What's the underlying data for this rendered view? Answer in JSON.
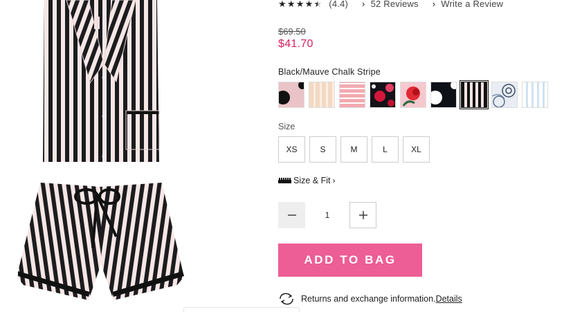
{
  "rating": {
    "stars_value": 4.4,
    "value_text": "(4.4)",
    "reviews_link": "52 Reviews",
    "write_review_link": "Write a Review"
  },
  "price": {
    "original": "$69.50",
    "sale": "$41.70",
    "sale_color": "#d6225f"
  },
  "color": {
    "selected_name": "Black/Mauve Chalk Stripe",
    "swatches": [
      {
        "name": "pink-black-dot",
        "selected": false
      },
      {
        "name": "beige-stripe",
        "selected": false
      },
      {
        "name": "pink-white-stripe",
        "selected": false
      },
      {
        "name": "black-red-floral",
        "selected": false
      },
      {
        "name": "pink-red-rose",
        "selected": false
      },
      {
        "name": "black-white-dot",
        "selected": false
      },
      {
        "name": "black-mauve-chalk-stripe",
        "selected": true
      },
      {
        "name": "blue-rose-sketch",
        "selected": false
      },
      {
        "name": "blue-white-stripe",
        "selected": false
      }
    ]
  },
  "size": {
    "label": "Size",
    "options": [
      "XS",
      "S",
      "M",
      "L",
      "XL"
    ],
    "fit_link": "Size & Fit",
    "fit_icon": "ruler-icon"
  },
  "quantity": {
    "value": "1",
    "minus_icon": "minus-icon",
    "plus_icon": "plus-icon"
  },
  "cta": {
    "add_to_bag": "ADD TO BAG",
    "color": "#ed5d96"
  },
  "returns": {
    "text": "Returns and exchange information.",
    "link": "Details",
    "icon": "exchange-arrows-icon"
  }
}
